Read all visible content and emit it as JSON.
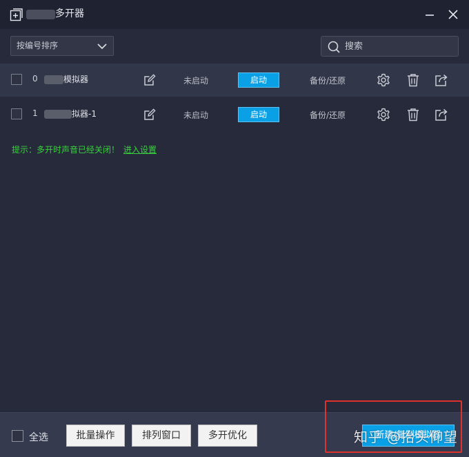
{
  "window": {
    "title": "多开器"
  },
  "toolbar": {
    "sort_selected": "按编号排序",
    "search_placeholder": "搜索"
  },
  "rows": [
    {
      "index": "0",
      "name": "模拟器",
      "status": "未启动",
      "start_label": "启动",
      "backup_label": "备份/还原"
    },
    {
      "index": "1",
      "name": "拟器-1",
      "status": "未启动",
      "start_label": "启动",
      "backup_label": "备份/还原"
    }
  ],
  "hint": {
    "text": "提示：多开时声音已经关闭！",
    "link": "进入设置"
  },
  "footer": {
    "select_all": "全选",
    "batch_label": "批量操作",
    "arrange_label": "排列窗口",
    "optimize_label": "多开优化",
    "new_label": "新建/复制模拟器"
  },
  "watermark": "知乎 @抬头仰望",
  "colors": {
    "background": "#262a3a",
    "accent": "#0aa0e6",
    "hint": "#38d13c",
    "highlight": "#e0322c"
  }
}
